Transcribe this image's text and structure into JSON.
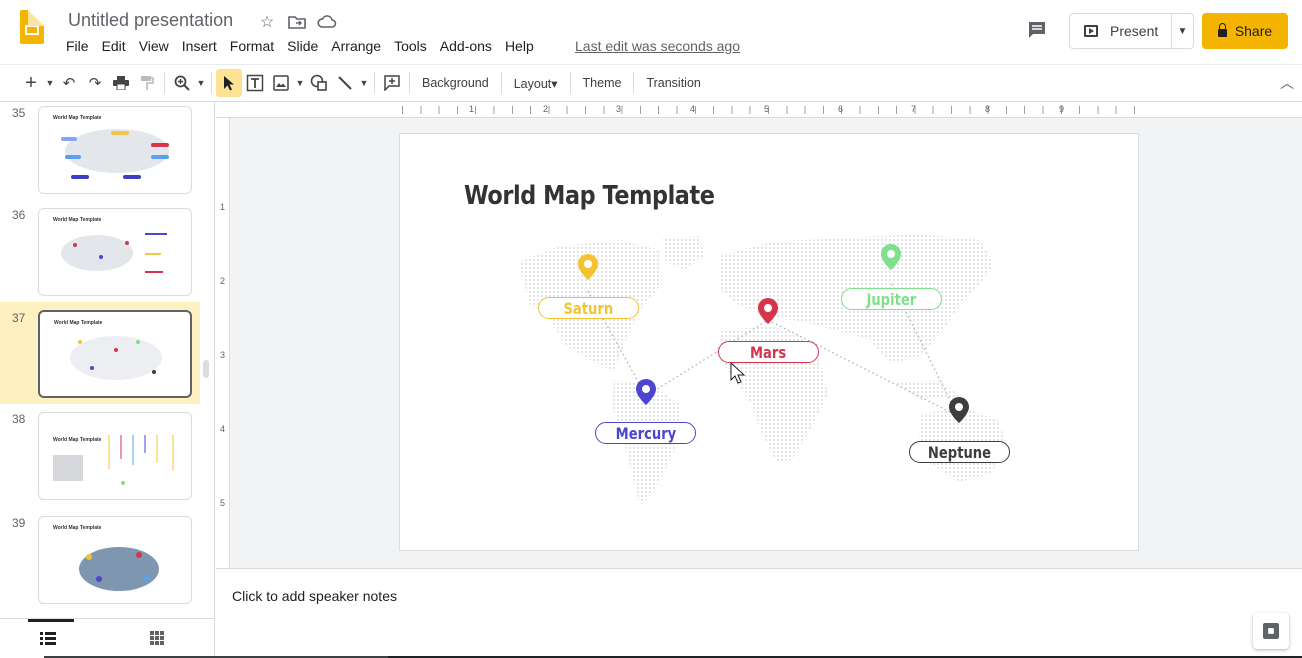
{
  "header": {
    "doc_title": "Untitled presentation",
    "menus": [
      "File",
      "Edit",
      "View",
      "Insert",
      "Format",
      "Slide",
      "Arrange",
      "Tools",
      "Add-ons",
      "Help"
    ],
    "last_edit": "Last edit was seconds ago",
    "present_label": "Present",
    "share_label": "Share"
  },
  "toolbar": {
    "background_label": "Background",
    "layout_label": "Layout▾",
    "theme_label": "Theme",
    "transition_label": "Transition"
  },
  "filmstrip": {
    "slides": [
      {
        "number": "35",
        "heading": "World Map Template"
      },
      {
        "number": "36",
        "heading": "World Map Template"
      },
      {
        "number": "37",
        "heading": "World Map Template",
        "selected": true
      },
      {
        "number": "38",
        "heading": "World Map Template"
      },
      {
        "number": "39",
        "heading": "World Map Template"
      }
    ]
  },
  "ruler": {
    "h_labels": [
      "1",
      "2",
      "3",
      "4",
      "5",
      "6",
      "7",
      "8",
      "9"
    ],
    "v_labels": [
      "1",
      "2",
      "3",
      "4",
      "5"
    ]
  },
  "slide": {
    "title": "World Map Template",
    "pins": [
      {
        "label": "Saturn",
        "color": "#f4c430"
      },
      {
        "label": "Jupiter",
        "color": "#7ee08a"
      },
      {
        "label": "Mars",
        "color": "#d6344a"
      },
      {
        "label": "Mercury",
        "color": "#4b45d1"
      },
      {
        "label": "Neptune",
        "color": "#3d3d3d"
      }
    ]
  },
  "notes": {
    "placeholder": "Click to add speaker notes"
  },
  "colors": {
    "accent": "#f4b400",
    "selected_thumb_bg": "#fdf0c1"
  }
}
